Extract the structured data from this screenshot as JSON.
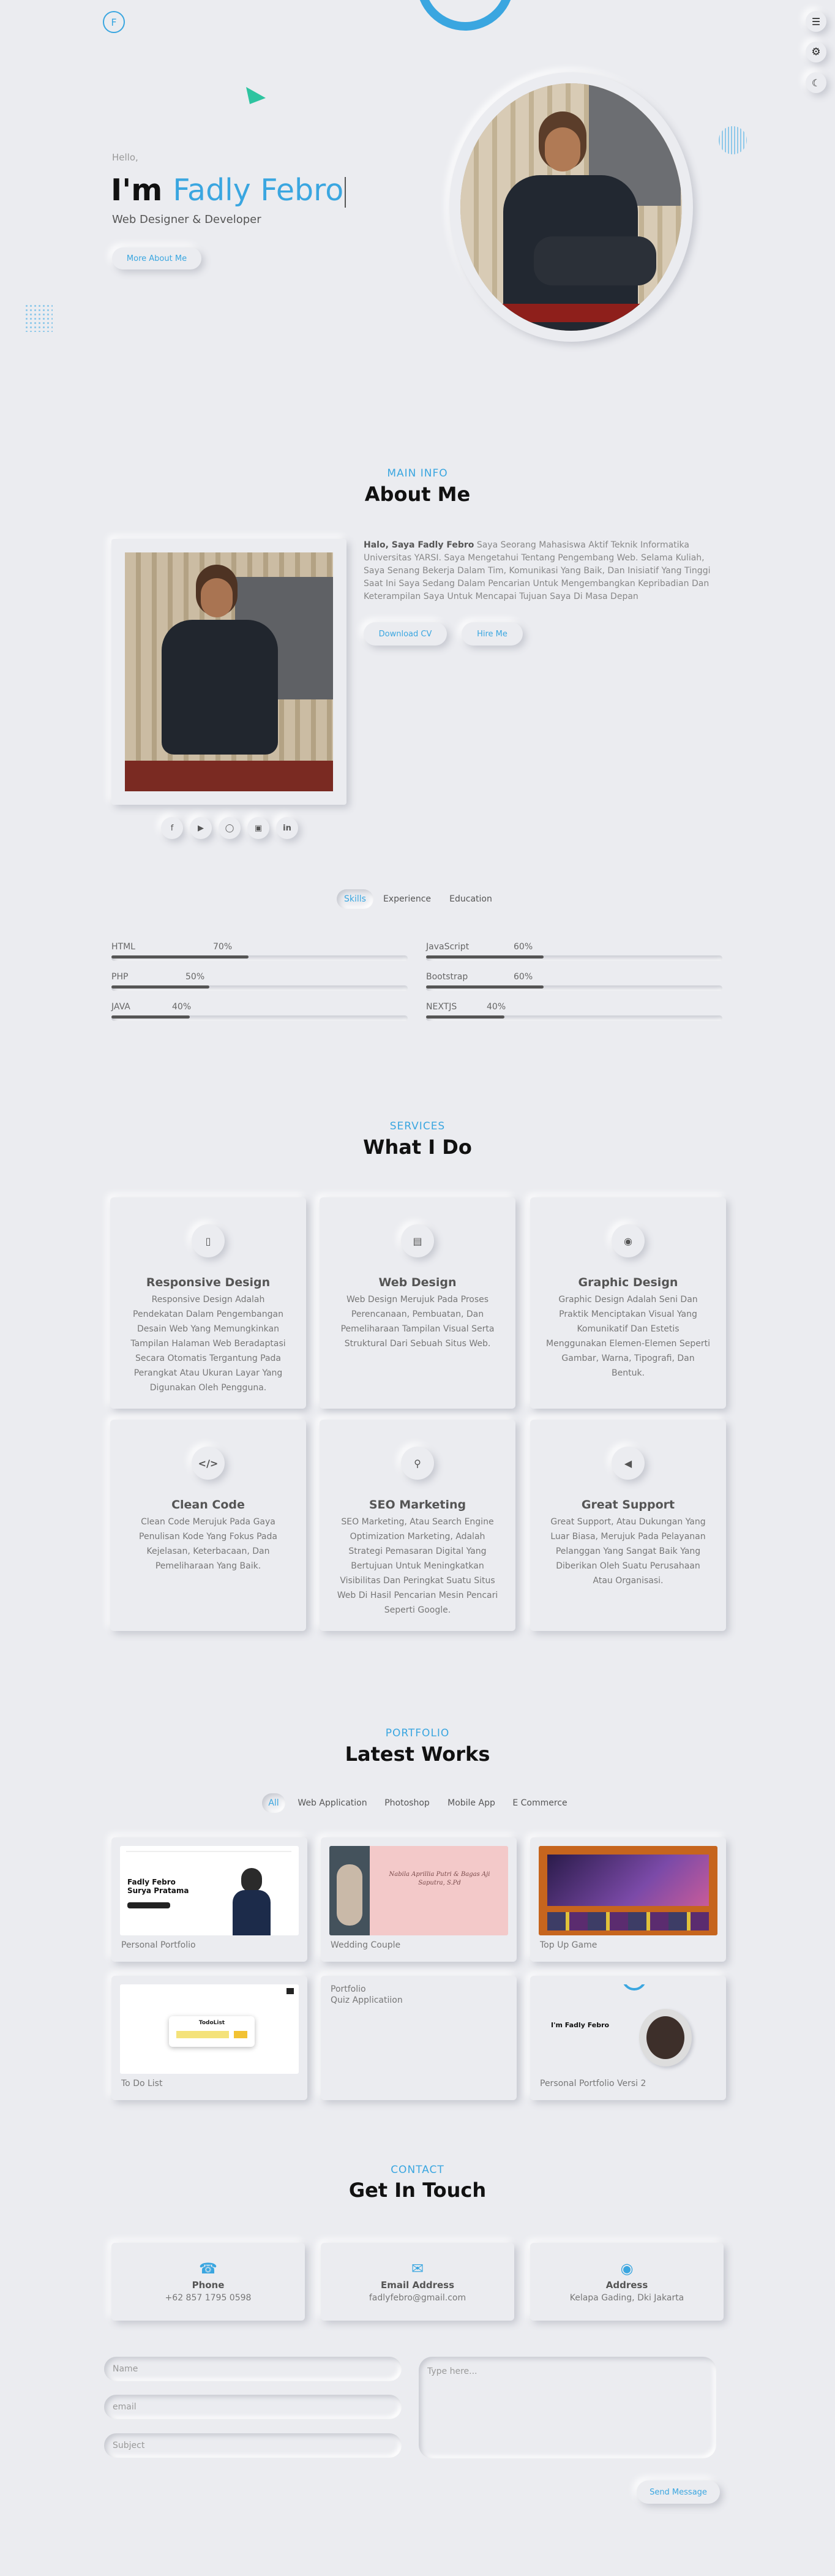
{
  "nav": {
    "logo_letter": "F",
    "menu_icon": "menu-icon",
    "settings_icon": "gear-icon",
    "theme_icon": "moon-icon"
  },
  "hero": {
    "greeting": "Hello,",
    "prefix": "I'm",
    "name": "Fadly Febro",
    "role": "Web Designer & Developer",
    "cta": "More About Me"
  },
  "about": {
    "subtitle": "MAIN INFO",
    "title": "About Me",
    "intro_bold": "Halo, Saya Fadly Febro",
    "intro_text": " Saya Seorang Mahasiswa Aktif Teknik Informatika Universitas YARSI. Saya Mengetahui Tentang Pengembang Web. Selama Kuliah, Saya Senang Bekerja Dalam Tim, Komunikasi Yang Baik, Dan Inisiatif Yang Tinggi Saat Ini Saya Sedang Dalam Pencarian Untuk Mengembangkan Kepribadian Dan Keterampilan Saya Untuk Mencapai Tujuan Saya Di Masa Depan",
    "download_cv": "Download CV",
    "hire_me": "Hire Me",
    "socials": [
      "facebook-icon",
      "youtube-icon",
      "github-icon",
      "instagram-icon",
      "linkedin-icon"
    ]
  },
  "tabs": {
    "items": [
      "Skills",
      "Experience",
      "Education"
    ],
    "active": "Skills"
  },
  "skills": [
    {
      "name": "HTML",
      "percent": 70,
      "label": "70%"
    },
    {
      "name": "JavaScript",
      "percent": 60,
      "label": "60%"
    },
    {
      "name": "PHP",
      "percent": 50,
      "label": "50%"
    },
    {
      "name": "Bootstrap",
      "percent": 60,
      "label": "60%"
    },
    {
      "name": "JAVA",
      "percent": 40,
      "label": "40%"
    },
    {
      "name": "NEXTJS",
      "percent": 40,
      "label": "40%"
    }
  ],
  "services": {
    "subtitle": "SERVICES",
    "title": "What I Do",
    "items": [
      {
        "icon": "mobile-icon",
        "title": "Responsive Design",
        "desc": "Responsive Design Adalah Pendekatan Dalam Pengembangan Desain Web Yang Memungkinkan Tampilan Halaman Web Beradaptasi Secara Otomatis Tergantung Pada Perangkat Atau Ukuran Layar Yang Digunakan Oleh Pengguna."
      },
      {
        "icon": "laptop-icon",
        "title": "Web Design",
        "desc": "Web Design Merujuk Pada Proses Perencanaan, Pembuatan, Dan Pemeliharaan Tampilan Visual Serta Struktural Dari Sebuah Situs Web."
      },
      {
        "icon": "palette-icon",
        "title": "Graphic Design",
        "desc": "Graphic Design Adalah Seni Dan Praktik Menciptakan Visual Yang Komunikatif Dan Estetis Menggunakan Elemen-Elemen Seperti Gambar, Warna, Tipografi, Dan Bentuk."
      },
      {
        "icon": "code-icon",
        "title": "Clean Code",
        "desc": "Clean Code Merujuk Pada Gaya Penulisan Kode Yang Fokus Pada Kejelasan, Keterbacaan, Dan Pemeliharaan Yang Baik."
      },
      {
        "icon": "search-icon",
        "title": "SEO Marketing",
        "desc": "SEO Marketing, Atau Search Engine Optimization Marketing, Adalah Strategi Pemasaran Digital Yang Bertujuan Untuk Meningkatkan Visibilitas Dan Peringkat Suatu Situs Web Di Hasil Pencarian Mesin Pencari Seperti Google."
      },
      {
        "icon": "megaphone-icon",
        "title": "Great Support",
        "desc": "Great Support, Atau Dukungan Yang Luar Biasa, Merujuk Pada Pelayanan Pelanggan Yang Sangat Baik Yang Diberikan Oleh Suatu Perusahaan Atau Organisasi."
      }
    ]
  },
  "portfolio": {
    "subtitle": "PORTFOLIO",
    "title": "Latest Works",
    "filters": [
      "All",
      "Web Application",
      "Photoshop",
      "Mobile App",
      "E Commerce"
    ],
    "active_filter": "All",
    "items": [
      {
        "label": "Personal Portfolio",
        "thumb_text": "Fadly Febro Surya Pratama"
      },
      {
        "label": "Wedding Couple",
        "thumb_text": "Nabila Aprillia Putri & Bagas Aji Saputra, S.Pd"
      },
      {
        "label": "Top Up Game",
        "thumb_text": ""
      },
      {
        "label": "To Do List",
        "thumb_text": "TodoList"
      },
      {
        "label": "Quiz Applicatiion",
        "thumb_text": "Portfolio"
      },
      {
        "label": "Personal Portfolio Versi 2",
        "thumb_text": "I'm Fadly Febro"
      }
    ]
  },
  "contact": {
    "subtitle": "CONTACT",
    "title": "Get In Touch",
    "cards": [
      {
        "icon": "phone-icon",
        "title": "Phone",
        "value": "+62 857 1795 0598"
      },
      {
        "icon": "envelope-icon",
        "title": "Email Address",
        "value": "fadlyfebro@gmail.com"
      },
      {
        "icon": "location-icon",
        "title": "Address",
        "value": "Kelapa Gading, Dki Jakarta"
      }
    ],
    "form": {
      "name_placeholder": "Name",
      "email_placeholder": "email",
      "subject_placeholder": "Subject",
      "message_placeholder": "Type here...",
      "send_label": "Send Message"
    }
  },
  "colors": {
    "accent": "#3aa6e0",
    "background": "#ebecf0",
    "triangle": "#2ec4a0"
  }
}
